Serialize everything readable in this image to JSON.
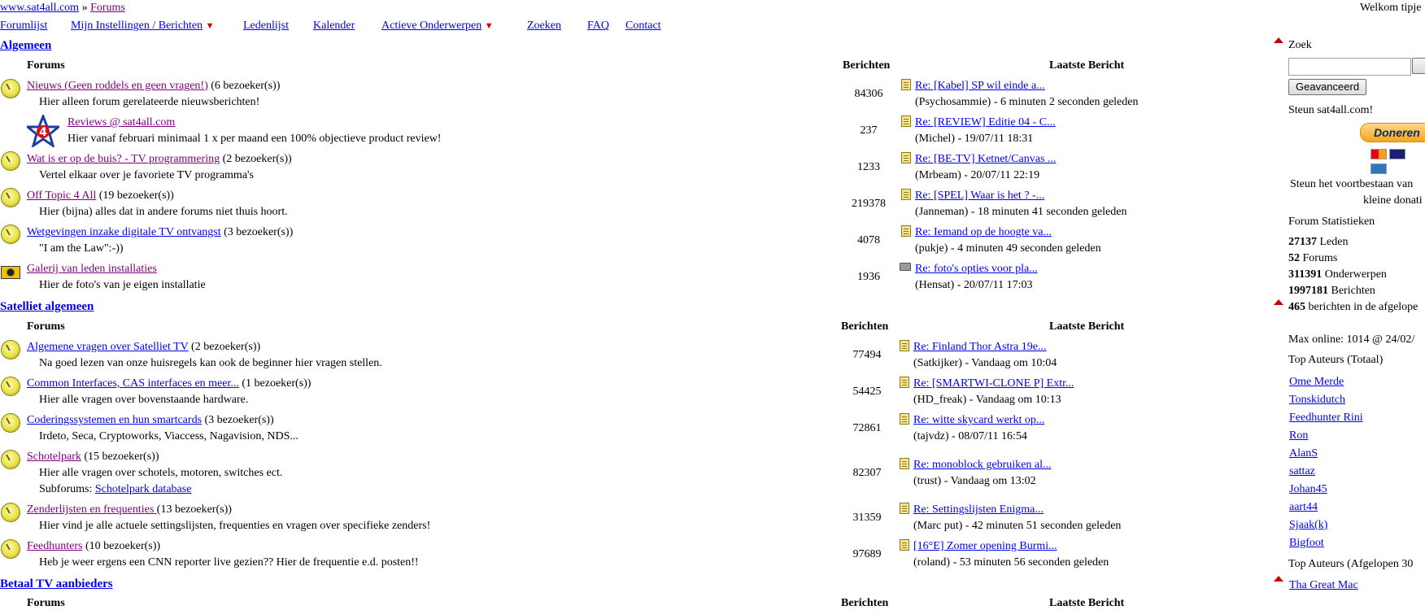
{
  "breadcrumb": {
    "site": "www.sat4all.com",
    "sep": " » ",
    "page": "Forums"
  },
  "welcome": "Welkom tipje",
  "nav": {
    "forumlijst": "Forumlijst",
    "instellingen": "Mijn Instellingen / Berichten",
    "ledenlijst": "Ledenlijst",
    "kalender": "Kalender",
    "actieve": "Actieve Onderwerpen",
    "zoeken": "Zoeken",
    "faq": "FAQ",
    "contact": "Contact"
  },
  "headers": {
    "forums": "Forums",
    "berichten": "Berichten",
    "laatste": "Laatste Bericht"
  },
  "sections": [
    {
      "title": "Algemeen",
      "forums": [
        {
          "name": "Nieuws (Geen roddels en geen vragen!)",
          "visitors": "(6 bezoeker(s))",
          "desc": "Hier alleen forum gerelateerde nieuwsberichten!",
          "count": "84306",
          "last": "Re: [Kabel] SP wil einde a...",
          "by": "(Psychosammie) - 6 minuten 2 seconden geleden"
        },
        {
          "name": "Reviews @ sat4all.com",
          "visitors": "",
          "desc": "Hier vanaf februari minimaal 1 x per maand een 100% objectieve product review!",
          "count": "237",
          "last": "Re: [REVIEW] Editie 04 - C...",
          "by": "(Michel) - 19/07/11 18:31"
        },
        {
          "name": "Wat is er op de buis? - TV programmering",
          "visitors": "(2 bezoeker(s))",
          "desc": "Vertel elkaar over je favoriete TV programma's",
          "count": "1233",
          "last": "Re: [BE-TV] Ketnet/Canvas ...",
          "by": "(Mrbeam) - 20/07/11 22:19"
        },
        {
          "name": "Off Topic 4 All",
          "visitors": "(19 bezoeker(s))",
          "desc": "Hier (bijna) alles dat in andere forums niet thuis hoort.",
          "count": "219378",
          "last": "Re: [SPEL] Waar is het ? -...",
          "by": "(Janneman) - 18 minuten 41 seconden geleden"
        },
        {
          "name": "Wetgevingen inzake digitale TV ontvangst",
          "visitors": "(3 bezoeker(s))",
          "desc": "\"I am the Law\":-))",
          "count": "4078",
          "last": "Re: Iemand op de hoogte va...",
          "by": "(pukje) - 4 minuten 49 seconden geleden"
        },
        {
          "name": "Galerij van leden installaties",
          "visitors": "",
          "desc": "Hier de foto's van je eigen installatie",
          "count": "1936",
          "last": "Re: foto's opties voor pla...",
          "by": "(Hensat) - 20/07/11 17:03"
        }
      ]
    },
    {
      "title": "Satelliet algemeen",
      "forums": [
        {
          "name": "Algemene vragen over Satelliet TV",
          "visitors": "(2 bezoeker(s))",
          "desc": "Na goed lezen van onze huisregels kan ook de beginner hier vragen stellen.",
          "count": "77494",
          "last": "Re: Finland Thor Astra 19e...",
          "by": "(Satkijker) - Vandaag om 10:04"
        },
        {
          "name": "Common Interfaces, CAS interfaces en meer...",
          "visitors": "(1 bezoeker(s))",
          "desc": "Hier alle vragen over bovenstaande hardware.",
          "count": "54425",
          "last": "Re: [SMARTWI-CLONE P] Extr...",
          "by": "(HD_freak) - Vandaag om 10:13"
        },
        {
          "name": "Coderingssystemen en hun smartcards",
          "visitors": "(3 bezoeker(s))",
          "desc": "Irdeto, Seca, Cryptoworks, Viaccess, Nagavision, NDS...",
          "count": "72861",
          "last": "Re: witte skycard werkt op...",
          "by": "(tajvdz) - 08/07/11 16:54"
        },
        {
          "name": "Schotelpark",
          "visitors": "(15 bezoeker(s))",
          "desc": "Hier alle vragen over schotels, motoren, switches ect.",
          "subforums_label": "Subforums:",
          "subforum": "Schotelpark database",
          "count": "82307",
          "last": "Re: monoblock gebruiken al...",
          "by": "(trust) - Vandaag om 13:02"
        },
        {
          "name": "Zenderlijsten en frequenties ",
          "visitors": "(13 bezoeker(s))",
          "desc": "Hier vind je alle actuele settingslijsten, frequenties en vragen over specifieke zenders!",
          "count": "31359",
          "last": "Re: Settingslijsten Enigma...",
          "by": "(Marc put) - 42 minuten 51 seconden geleden"
        },
        {
          "name": "Feedhunters",
          "visitors": "(10 bezoeker(s))",
          "desc": "Heb je weer ergens een CNN reporter live gezien?? Hier de frequentie e.d. posten!!",
          "count": "97689",
          "last": "[16°E] Zomer opening Burmi...",
          "by": "(roland) - 53 minuten 56 seconden geleden"
        }
      ]
    },
    {
      "title": "Betaal TV aanbieders"
    }
  ],
  "sidebar": {
    "zoek": "Zoek",
    "search_value": "",
    "advanced": "Geavanceerd",
    "steun": "Steun sat4all.com!",
    "donate": "Doneren",
    "steun2a": "Steun het voortbestaan van",
    "steun2b": "kleine donati",
    "stats_title": "Forum Statistieken",
    "stats": [
      {
        "num": "27137",
        "label": " Leden"
      },
      {
        "num": "52",
        "label": " Forums"
      },
      {
        "num": "311391",
        "label": " Onderwerpen"
      },
      {
        "num": "1997181",
        "label": " Berichten"
      },
      {
        "num": "465",
        "label": " berichten in de afgelope"
      }
    ],
    "max_online": "Max online: 1014 @ 24/02/",
    "top_total": "Top Auteurs (Totaal)",
    "authors": [
      "Ome Merde",
      "Tonskidutch",
      "Feedhunter Rini",
      "Ron",
      "AlanS",
      "sattaz",
      "Johan45",
      "aart44",
      "Sjaak(k)",
      "Bigfoot"
    ],
    "top_30": "Top Auteurs (Afgelopen 30",
    "authors30": [
      "Tha Great Mac"
    ]
  }
}
